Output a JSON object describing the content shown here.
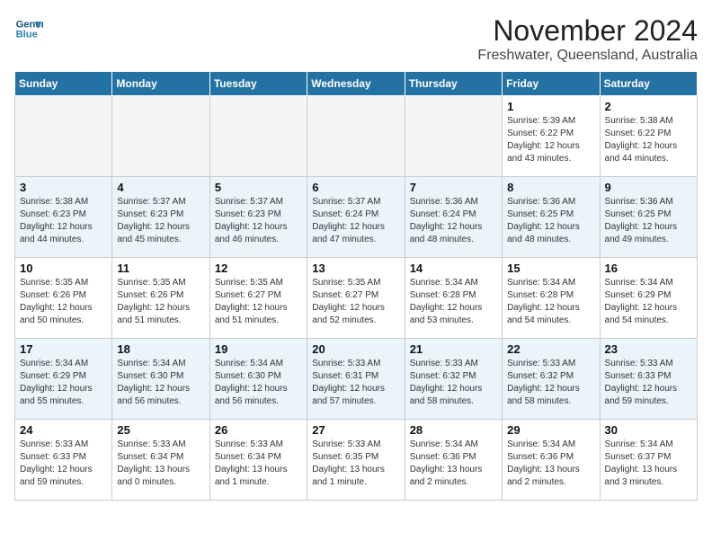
{
  "header": {
    "logo_line1": "General",
    "logo_line2": "Blue",
    "month": "November 2024",
    "location": "Freshwater, Queensland, Australia"
  },
  "weekdays": [
    "Sunday",
    "Monday",
    "Tuesday",
    "Wednesday",
    "Thursday",
    "Friday",
    "Saturday"
  ],
  "weeks": [
    [
      {
        "day": "",
        "info": ""
      },
      {
        "day": "",
        "info": ""
      },
      {
        "day": "",
        "info": ""
      },
      {
        "day": "",
        "info": ""
      },
      {
        "day": "",
        "info": ""
      },
      {
        "day": "1",
        "info": "Sunrise: 5:39 AM\nSunset: 6:22 PM\nDaylight: 12 hours\nand 43 minutes."
      },
      {
        "day": "2",
        "info": "Sunrise: 5:38 AM\nSunset: 6:22 PM\nDaylight: 12 hours\nand 44 minutes."
      }
    ],
    [
      {
        "day": "3",
        "info": "Sunrise: 5:38 AM\nSunset: 6:23 PM\nDaylight: 12 hours\nand 44 minutes."
      },
      {
        "day": "4",
        "info": "Sunrise: 5:37 AM\nSunset: 6:23 PM\nDaylight: 12 hours\nand 45 minutes."
      },
      {
        "day": "5",
        "info": "Sunrise: 5:37 AM\nSunset: 6:23 PM\nDaylight: 12 hours\nand 46 minutes."
      },
      {
        "day": "6",
        "info": "Sunrise: 5:37 AM\nSunset: 6:24 PM\nDaylight: 12 hours\nand 47 minutes."
      },
      {
        "day": "7",
        "info": "Sunrise: 5:36 AM\nSunset: 6:24 PM\nDaylight: 12 hours\nand 48 minutes."
      },
      {
        "day": "8",
        "info": "Sunrise: 5:36 AM\nSunset: 6:25 PM\nDaylight: 12 hours\nand 48 minutes."
      },
      {
        "day": "9",
        "info": "Sunrise: 5:36 AM\nSunset: 6:25 PM\nDaylight: 12 hours\nand 49 minutes."
      }
    ],
    [
      {
        "day": "10",
        "info": "Sunrise: 5:35 AM\nSunset: 6:26 PM\nDaylight: 12 hours\nand 50 minutes."
      },
      {
        "day": "11",
        "info": "Sunrise: 5:35 AM\nSunset: 6:26 PM\nDaylight: 12 hours\nand 51 minutes."
      },
      {
        "day": "12",
        "info": "Sunrise: 5:35 AM\nSunset: 6:27 PM\nDaylight: 12 hours\nand 51 minutes."
      },
      {
        "day": "13",
        "info": "Sunrise: 5:35 AM\nSunset: 6:27 PM\nDaylight: 12 hours\nand 52 minutes."
      },
      {
        "day": "14",
        "info": "Sunrise: 5:34 AM\nSunset: 6:28 PM\nDaylight: 12 hours\nand 53 minutes."
      },
      {
        "day": "15",
        "info": "Sunrise: 5:34 AM\nSunset: 6:28 PM\nDaylight: 12 hours\nand 54 minutes."
      },
      {
        "day": "16",
        "info": "Sunrise: 5:34 AM\nSunset: 6:29 PM\nDaylight: 12 hours\nand 54 minutes."
      }
    ],
    [
      {
        "day": "17",
        "info": "Sunrise: 5:34 AM\nSunset: 6:29 PM\nDaylight: 12 hours\nand 55 minutes."
      },
      {
        "day": "18",
        "info": "Sunrise: 5:34 AM\nSunset: 6:30 PM\nDaylight: 12 hours\nand 56 minutes."
      },
      {
        "day": "19",
        "info": "Sunrise: 5:34 AM\nSunset: 6:30 PM\nDaylight: 12 hours\nand 56 minutes."
      },
      {
        "day": "20",
        "info": "Sunrise: 5:33 AM\nSunset: 6:31 PM\nDaylight: 12 hours\nand 57 minutes."
      },
      {
        "day": "21",
        "info": "Sunrise: 5:33 AM\nSunset: 6:32 PM\nDaylight: 12 hours\nand 58 minutes."
      },
      {
        "day": "22",
        "info": "Sunrise: 5:33 AM\nSunset: 6:32 PM\nDaylight: 12 hours\nand 58 minutes."
      },
      {
        "day": "23",
        "info": "Sunrise: 5:33 AM\nSunset: 6:33 PM\nDaylight: 12 hours\nand 59 minutes."
      }
    ],
    [
      {
        "day": "24",
        "info": "Sunrise: 5:33 AM\nSunset: 6:33 PM\nDaylight: 12 hours\nand 59 minutes."
      },
      {
        "day": "25",
        "info": "Sunrise: 5:33 AM\nSunset: 6:34 PM\nDaylight: 13 hours\nand 0 minutes."
      },
      {
        "day": "26",
        "info": "Sunrise: 5:33 AM\nSunset: 6:34 PM\nDaylight: 13 hours\nand 1 minute."
      },
      {
        "day": "27",
        "info": "Sunrise: 5:33 AM\nSunset: 6:35 PM\nDaylight: 13 hours\nand 1 minute."
      },
      {
        "day": "28",
        "info": "Sunrise: 5:34 AM\nSunset: 6:36 PM\nDaylight: 13 hours\nand 2 minutes."
      },
      {
        "day": "29",
        "info": "Sunrise: 5:34 AM\nSunset: 6:36 PM\nDaylight: 13 hours\nand 2 minutes."
      },
      {
        "day": "30",
        "info": "Sunrise: 5:34 AM\nSunset: 6:37 PM\nDaylight: 13 hours\nand 3 minutes."
      }
    ]
  ]
}
